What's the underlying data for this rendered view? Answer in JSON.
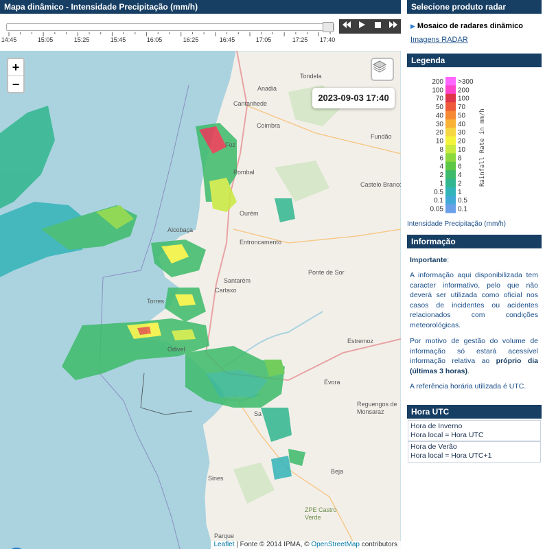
{
  "left_panel": {
    "title": "Mapa dinâmico - Intensidade Precipitação (mm/h)"
  },
  "timeline": {
    "tick_labels": [
      "14:45",
      "15:05",
      "15:25",
      "15:45",
      "16:05",
      "16:25",
      "16:45",
      "17:05",
      "17:25",
      "17:40"
    ],
    "current_position": 1.0,
    "controls": {
      "rewind_icon": "rewind-icon",
      "play_icon": "play-icon",
      "stop_icon": "stop-icon",
      "forward_icon": "fast-forward-icon"
    }
  },
  "map": {
    "zoom_in": "+",
    "zoom_out": "−",
    "timestamp": "2023-09-03 17:40",
    "place_labels": {
      "tondela": "Tondela",
      "anadia": "Anadia",
      "cantanhede": "Cantanhede",
      "coimbra": "Coimbra",
      "fundao": "Fundão",
      "pombal": "Pombal",
      "castelo_branco": "Castelo Branco",
      "ourem": "Ourém",
      "alcobaca": "Alcobaça",
      "entroncamento": "Entroncamento",
      "ponte_de_sor": "Ponte de Sor",
      "santarem": "Santarém",
      "cartaxo": "Cartaxo",
      "torres": "Torres",
      "estremoz": "Estremoz",
      "odivelas": "Odivel",
      "evora": "Évora",
      "reguengos": "Reguengos de Monsaraz",
      "sines": "Sines",
      "beja": "Beja",
      "castro_verde": "ZPE Castro Verde",
      "parque": "Parque",
      "figueira": "Foz",
      "sa": "Sa"
    },
    "attribution": {
      "leaflet": "Leaflet",
      "source": " | Fonte © 2014 IPMA, © ",
      "osm": "OpenStreetMap",
      "contributors": " contributors"
    }
  },
  "right_panel": {
    "product_header": "Selecione produto radar",
    "product_selected": "Mosaico de radares dinâmico",
    "images_link": "Imagens RADAR",
    "legend_header": "Legenda",
    "legend": {
      "rate_label": "Rainfall Rate in mm/h",
      "left_values": [
        "200",
        "100",
        "70",
        "50",
        "40",
        "30",
        "20",
        "10",
        "8",
        "6",
        "4",
        "2",
        "1",
        "0.5",
        "0.1",
        "0.05"
      ],
      "right_values": [
        ">300",
        "200",
        "100",
        "70",
        "50",
        "40",
        "30",
        "20",
        "10",
        "8",
        "6",
        "4",
        "2",
        "1",
        "0.5",
        "0.1"
      ],
      "colors": [
        "#ff66ff",
        "#ff44cc",
        "#e0344a",
        "#ef5a3a",
        "#f58a32",
        "#f9b136",
        "#f6d743",
        "#f4f43c",
        "#c9ea3e",
        "#8cd93f",
        "#5cc845",
        "#3dbb6a",
        "#31b68f",
        "#33b4b8",
        "#43a9d6",
        "#6aa0e8"
      ],
      "caption": "Intensidade Precipitação (mm/h)"
    },
    "info_header": "Informação",
    "info": {
      "important_label": "Importante",
      "important_colon": ":",
      "p1": "A informação aqui disponibilizada tem caracter informativo, pelo que não deverá ser utilizada como oficial nos casos de incidentes ou acidentes relacionados com condições meteorológicas.",
      "p2_a": "Por motivo de gestão do volume de informação só estará acessível informação relativa ao ",
      "p2_b": "próprio dia (últimas 3 horas)",
      "p2_c": ".",
      "p3": "A referência horária utilizada é UTC."
    },
    "utc_header": "Hora UTC",
    "utc": {
      "winter_title": "Hora de Inverno",
      "winter_value": "Hora local = Hora UTC",
      "summer_title": "Hora de Verão",
      "summer_value": "Hora local = Hora UTC+1"
    }
  }
}
